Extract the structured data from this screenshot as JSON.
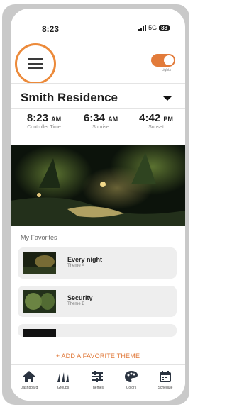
{
  "status": {
    "time": "8:23",
    "network": "5G",
    "battery": "88"
  },
  "header": {
    "toggle_label": "Lights"
  },
  "site": {
    "name": "Smith Residence"
  },
  "times": [
    {
      "value": "8:23",
      "period": "AM",
      "label": "Controller Time"
    },
    {
      "value": "6:34",
      "period": "AM",
      "label": "Sunrise"
    },
    {
      "value": "4:42",
      "period": "PM",
      "label": "Sunset"
    }
  ],
  "favorites": {
    "title": "My Favorites",
    "items": [
      {
        "name": "Every night",
        "sub": "Theme A"
      },
      {
        "name": "Security",
        "sub": "Theme B"
      }
    ],
    "add_label": "+ ADD A FAVORITE THEME"
  },
  "tabs": [
    {
      "label": "Dashboard",
      "icon": "home-icon"
    },
    {
      "label": "Groups",
      "icon": "groups-icon"
    },
    {
      "label": "Themes",
      "icon": "sliders-icon"
    },
    {
      "label": "Colors",
      "icon": "palette-icon"
    },
    {
      "label": "Schedule",
      "icon": "calendar-icon"
    }
  ],
  "colors": {
    "accent": "#e27b3a",
    "highlight_ring": "#ec8a3a"
  }
}
